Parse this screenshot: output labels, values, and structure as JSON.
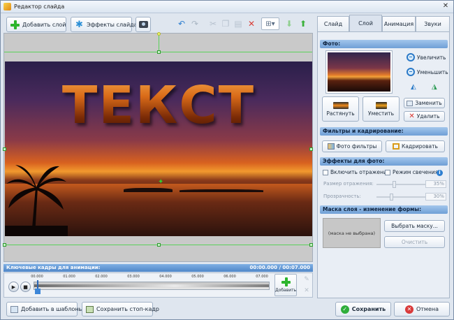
{
  "window": {
    "title": "Редактор слайда"
  },
  "toolbar": {
    "add_layer": "Добавить слой",
    "slide_effects": "Эффекты слайда"
  },
  "canvas": {
    "text": "ТЕКСТ"
  },
  "timeline": {
    "header": "Ключевые кадры для анимации:",
    "time": "00:00.000 / 00:07.000",
    "ticks": [
      "00.000",
      "01.000",
      "02.000",
      "03.000",
      "04.000",
      "05.000",
      "06.000",
      "07.000"
    ],
    "add_label": "Добавить"
  },
  "bottom": {
    "add_to_templates": "Добавить в шаблоны",
    "save_frame": "Сохранить стоп-кадр",
    "save": "Сохранить",
    "cancel": "Отмена"
  },
  "tabs": [
    "Слайд",
    "Слой",
    "Анимация",
    "Звуки"
  ],
  "active_tab": "Слой",
  "panel": {
    "photo": {
      "header": "Фото:",
      "zoom_in": "Увеличить",
      "zoom_out": "Уменьшить",
      "stretch": "Растянуть",
      "fit": "Уместить",
      "replace": "Заменить",
      "delete": "Удалить"
    },
    "filters": {
      "header": "Фильтры и кадрирование:",
      "photo_filters": "Фото фильтры",
      "crop": "Кадрировать"
    },
    "effects": {
      "header": "Эффекты для фото:",
      "reflection": "Включить отражение",
      "glow": "Режим свечения",
      "reflection_size_label": "Размер отражения:",
      "reflection_size_value": "35%",
      "reflection_size_level": 0.35,
      "transparency_label": "Прозрачность:",
      "transparency_value": "30%",
      "transparency_level": 0.3
    },
    "mask": {
      "header": "Маска слоя - изменение формы:",
      "placeholder": "(маска не выбрана)",
      "choose": "Выбрать маску...",
      "clear": "Очистить"
    }
  },
  "colors": {
    "accent": "#6f9fd6",
    "selection": "#5ad15a"
  }
}
